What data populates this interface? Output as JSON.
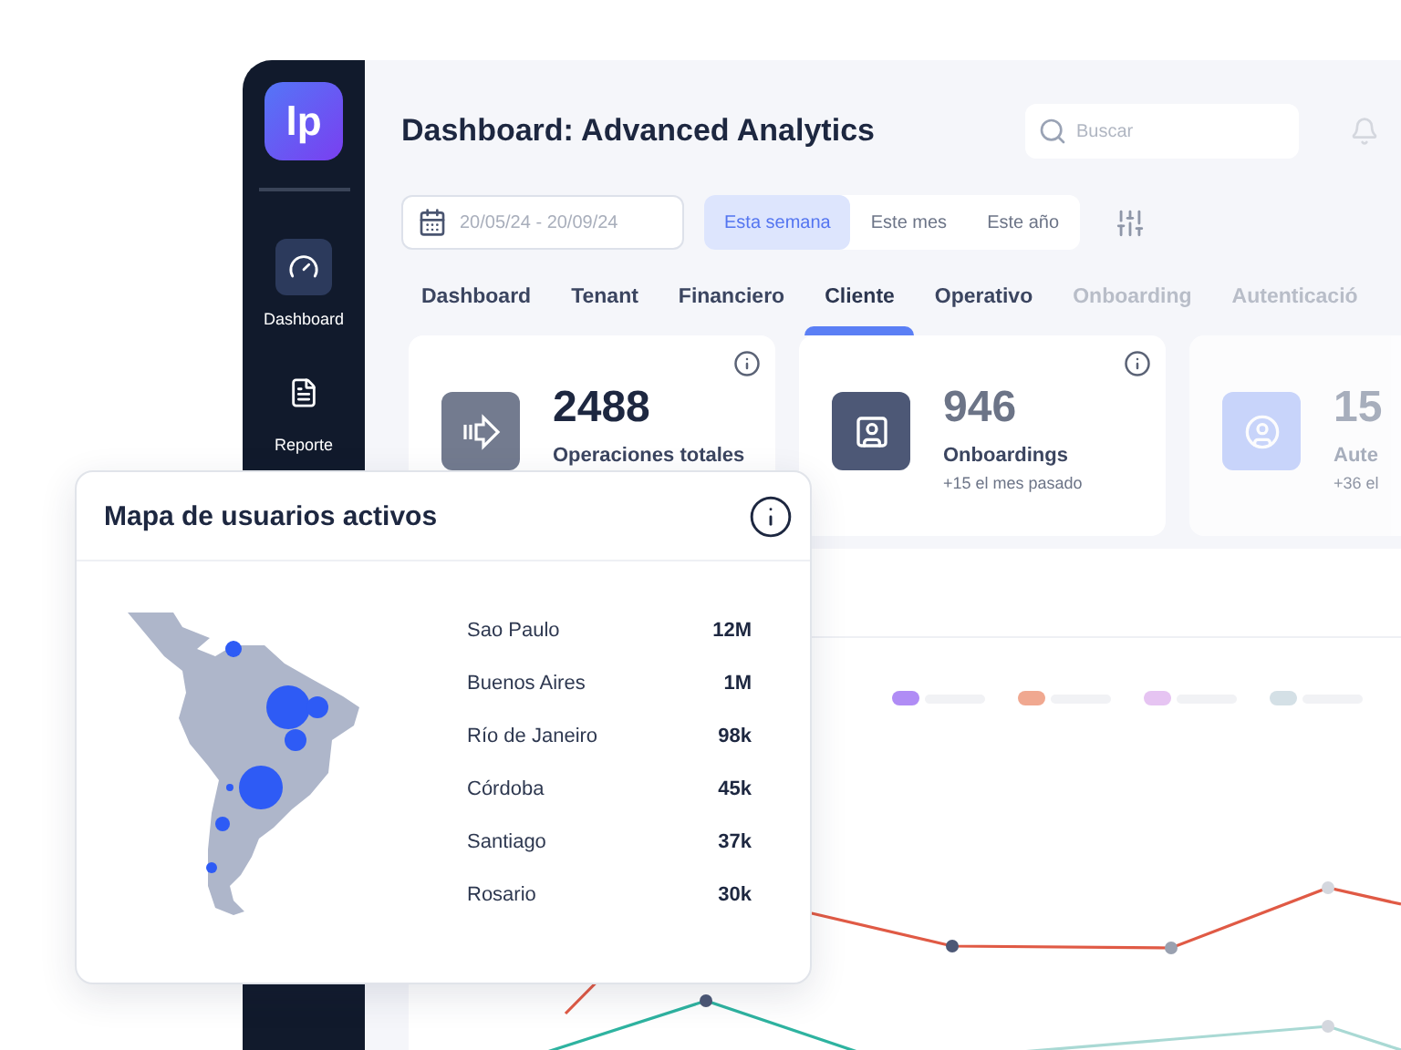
{
  "sidebar": {
    "logo": "lp",
    "items": [
      {
        "label": "Dashboard",
        "kind": "gauge",
        "selected": true
      },
      {
        "label": "Reporte",
        "kind": "document",
        "selected": false
      }
    ]
  },
  "header": {
    "title": "Dashboard: Advanced Analytics",
    "search": {
      "placeholder": "Buscar"
    }
  },
  "filters": {
    "date_range": "20/05/24 - 20/09/24",
    "periods": [
      {
        "label": "Esta semana",
        "selected": true
      },
      {
        "label": "Este mes",
        "selected": false
      },
      {
        "label": "Este año",
        "selected": false
      }
    ]
  },
  "tabs": [
    {
      "label": "Dashboard",
      "selected": false,
      "faded": false
    },
    {
      "label": "Tenant",
      "selected": false,
      "faded": false
    },
    {
      "label": "Financiero",
      "selected": false,
      "faded": false
    },
    {
      "label": "Cliente",
      "selected": true,
      "faded": false
    },
    {
      "label": "Operativo",
      "selected": false,
      "faded": false
    },
    {
      "label": "Onboarding",
      "selected": false,
      "faded": true
    },
    {
      "label": "Autenticació",
      "selected": false,
      "faded": true
    }
  ],
  "stat_cards": [
    {
      "kind": "operations",
      "value": "2488",
      "label": "Operaciones totales",
      "faded": false
    },
    {
      "kind": "onboarding",
      "value": "946",
      "label": "Onboardings",
      "note": "+15 el mes pasado",
      "faded": false
    },
    {
      "kind": "user",
      "value": "15",
      "label": "Aute",
      "note": "+36 el",
      "faded": true
    }
  ],
  "chart": {
    "legend": [
      {
        "color": "#b08cf5"
      },
      {
        "color": "#f0a890"
      },
      {
        "color": "#e6c4f2"
      },
      {
        "color": "#d4e0e6"
      }
    ]
  },
  "active_users_map": {
    "title": "Mapa de usuarios activos",
    "cities": [
      {
        "name": "Sao Paulo",
        "value": "12M"
      },
      {
        "name": "Buenos Aires",
        "value": "1M"
      },
      {
        "name": "Río de Janeiro",
        "value": "98k"
      },
      {
        "name": "Córdoba",
        "value": "45k"
      },
      {
        "name": "Santiago",
        "value": "37k"
      },
      {
        "name": "Rosario",
        "value": "30k"
      }
    ]
  }
}
